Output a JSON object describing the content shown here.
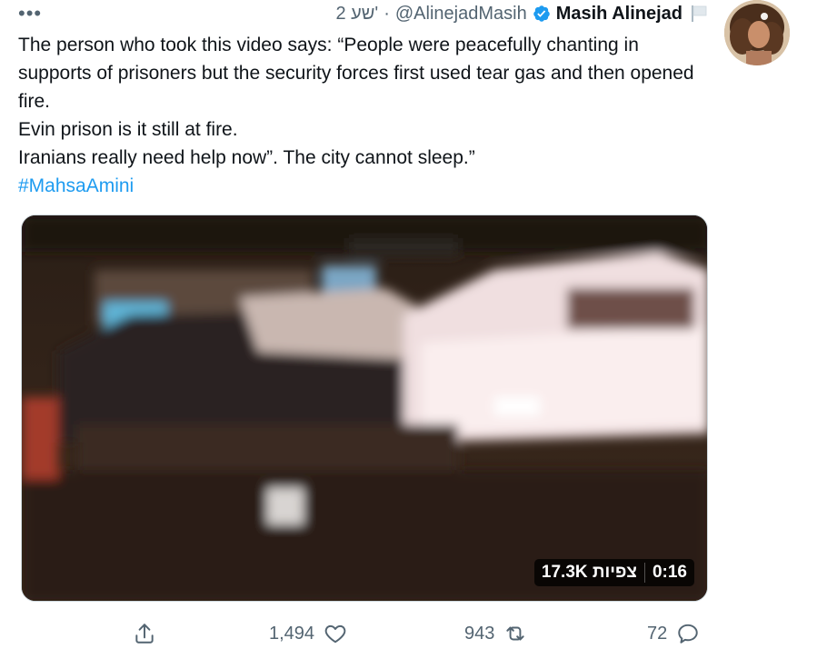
{
  "tweet": {
    "more_glyph": "•••",
    "author_name": "Masih Alinejad",
    "handle": "@AlinejadMasih",
    "separator": "·",
    "time": "2 שע'",
    "text_lines": [
      "The person who took this video says: “People were peacefully chanting in supports of prisoners but the security forces first used tear gas and then opened fire.",
      "Evin prison is it still at fire.",
      "Iranians really need help now”. The city cannot sleep.”"
    ],
    "hashtag": "#MahsaAmini"
  },
  "media": {
    "views": "17.3K צפיות",
    "duration": "0:16"
  },
  "actions": {
    "share_icon": "share-icon",
    "likes": "1,494",
    "like_icon": "heart-icon",
    "retweets": "943",
    "retweet_icon": "retweet-icon",
    "replies": "72",
    "reply_icon": "reply-icon"
  },
  "colors": {
    "link": "#1d9bf0",
    "verified": "#1d9bf0",
    "secondary_text": "#536471"
  }
}
